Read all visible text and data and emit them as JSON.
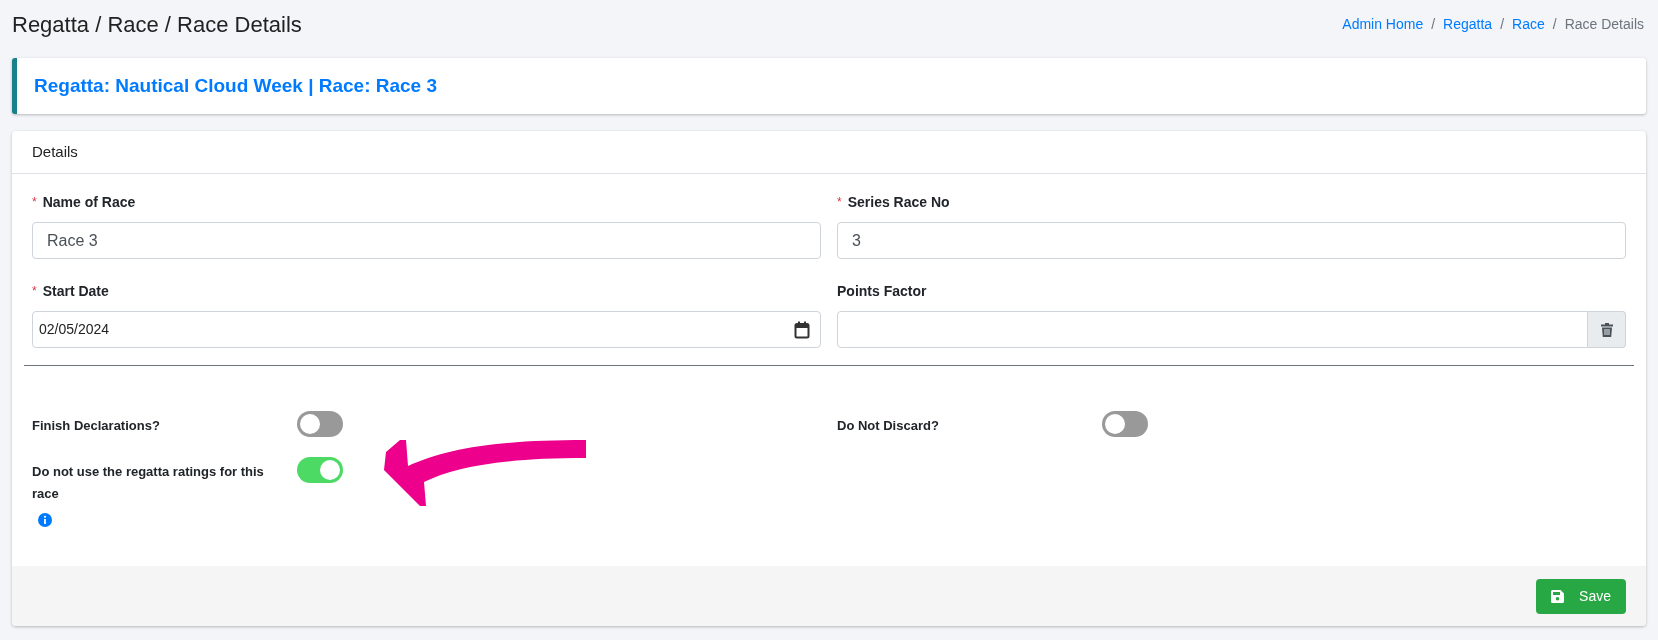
{
  "page_title": "Regatta / Race / Race Details",
  "breadcrumb": [
    {
      "label": "Admin Home",
      "kind": "link"
    },
    {
      "separator": "/",
      "label": "Regatta",
      "kind": "link"
    },
    {
      "separator": "/",
      "label": "Race",
      "kind": "link"
    },
    {
      "separator": "/",
      "label": "Race Details",
      "kind": "current"
    }
  ],
  "banner": "Regatta: Nautical Cloud Week | Race: Race 3",
  "card_title": "Details",
  "fields": [
    {
      "required_mark": "*",
      "label": "Name of Race",
      "kind": "text",
      "value": "Race 3"
    },
    {
      "required_mark": "*",
      "label": "Series Race No",
      "kind": "text",
      "value": "3"
    },
    {
      "required_mark": "*",
      "label": "Start Date",
      "kind": "date",
      "value": "02/05/2024"
    },
    {
      "label": "Points Factor",
      "kind": "clearable"
    }
  ],
  "toggle_columns": [
    [
      {
        "label": "Finish Declarations?",
        "on": false,
        "info": false
      },
      {
        "label": "Do not use the regatta ratings for this race",
        "on": true,
        "info": true
      }
    ],
    [
      {
        "label": "Do Not Discard?",
        "on": false,
        "info": false
      }
    ]
  ],
  "annotations": [
    {
      "kind": "arrow"
    }
  ],
  "save_button": "Save"
}
